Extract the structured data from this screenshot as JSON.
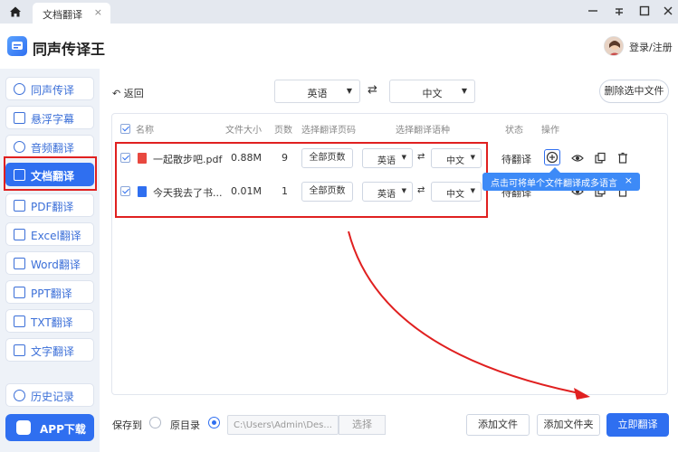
{
  "tabbar": {
    "tab_label": "文档翻译",
    "tab_close": "×"
  },
  "header": {
    "app_title": "同声传译王",
    "login_label": "登录/注册"
  },
  "sidebar": {
    "items": [
      {
        "label": "同声传译",
        "icon": "mic-icon"
      },
      {
        "label": "悬浮字幕",
        "icon": "subtitle-icon"
      },
      {
        "label": "音频翻译",
        "icon": "audio-icon"
      },
      {
        "label": "文档翻译",
        "icon": "document-icon"
      },
      {
        "label": "PDF翻译",
        "icon": "pdf-icon"
      },
      {
        "label": "Excel翻译",
        "icon": "excel-icon"
      },
      {
        "label": "Word翻译",
        "icon": "word-icon"
      },
      {
        "label": "PPT翻译",
        "icon": "ppt-icon"
      },
      {
        "label": "TXT翻译",
        "icon": "txt-icon"
      },
      {
        "label": "文字翻译",
        "icon": "text-icon"
      }
    ],
    "history_label": "历史记录",
    "app_download_label": "APP下载"
  },
  "toolbar": {
    "back_label": "返回",
    "source_lang": "英语",
    "target_lang": "中文",
    "swap_symbol": "⇄",
    "delete_selected_label": "删除选中文件"
  },
  "table": {
    "headers": {
      "name": "名称",
      "size": "文件大小",
      "pages": "页数",
      "page_range": "选择翻译页码",
      "language": "选择翻译语种",
      "status": "状态",
      "actions": "操作"
    },
    "rows": [
      {
        "name": "一起散步吧.pdf",
        "type": "pdf",
        "size": "0.88M",
        "pages": "9",
        "page_range": "全部页数",
        "source": "英语",
        "target": "中文",
        "status": "待翻译"
      },
      {
        "name": "今天我去了书...",
        "type": "word",
        "size": "0.01M",
        "pages": "1",
        "page_range": "全部页数",
        "source": "英语",
        "target": "中文",
        "status": "待翻译"
      }
    ],
    "swap_symbol": "⇄"
  },
  "tooltip": {
    "text": "点击可将单个文件翻译成多语言",
    "close": "×"
  },
  "footer": {
    "save_to_label": "保存到",
    "original_dir_label": "原目录",
    "original_dir_selected": true,
    "path_value": "C:\\Users\\Admin\\Des...",
    "choose_label": "选择",
    "add_file_label": "添加文件",
    "add_folder_label": "添加文件夹",
    "translate_label": "立即翻译"
  },
  "colors": {
    "accent": "#2f6ff0",
    "highlight_red": "#e02020",
    "tooltip_bg": "#3d8af7"
  }
}
